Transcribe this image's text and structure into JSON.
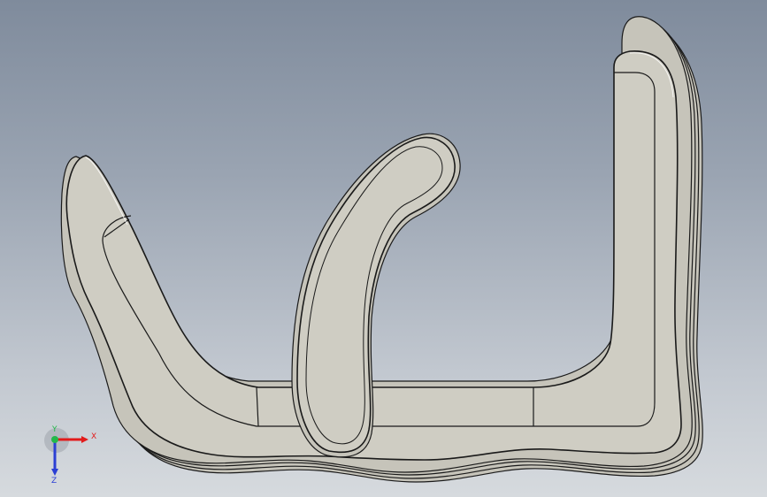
{
  "viewport": {
    "background_top": "#7f8b9c",
    "background_bottom": "#d6dade"
  },
  "model": {
    "face_color": "#cfcdc3",
    "edge_color": "#1a1a1a",
    "layer_color": "#c6c4ba"
  },
  "triad": {
    "x_label": "X",
    "y_label": "Y",
    "z_label": "Z",
    "x_color": "#e21b1b",
    "y_color": "#23b84a",
    "z_color": "#2b3fd4"
  }
}
